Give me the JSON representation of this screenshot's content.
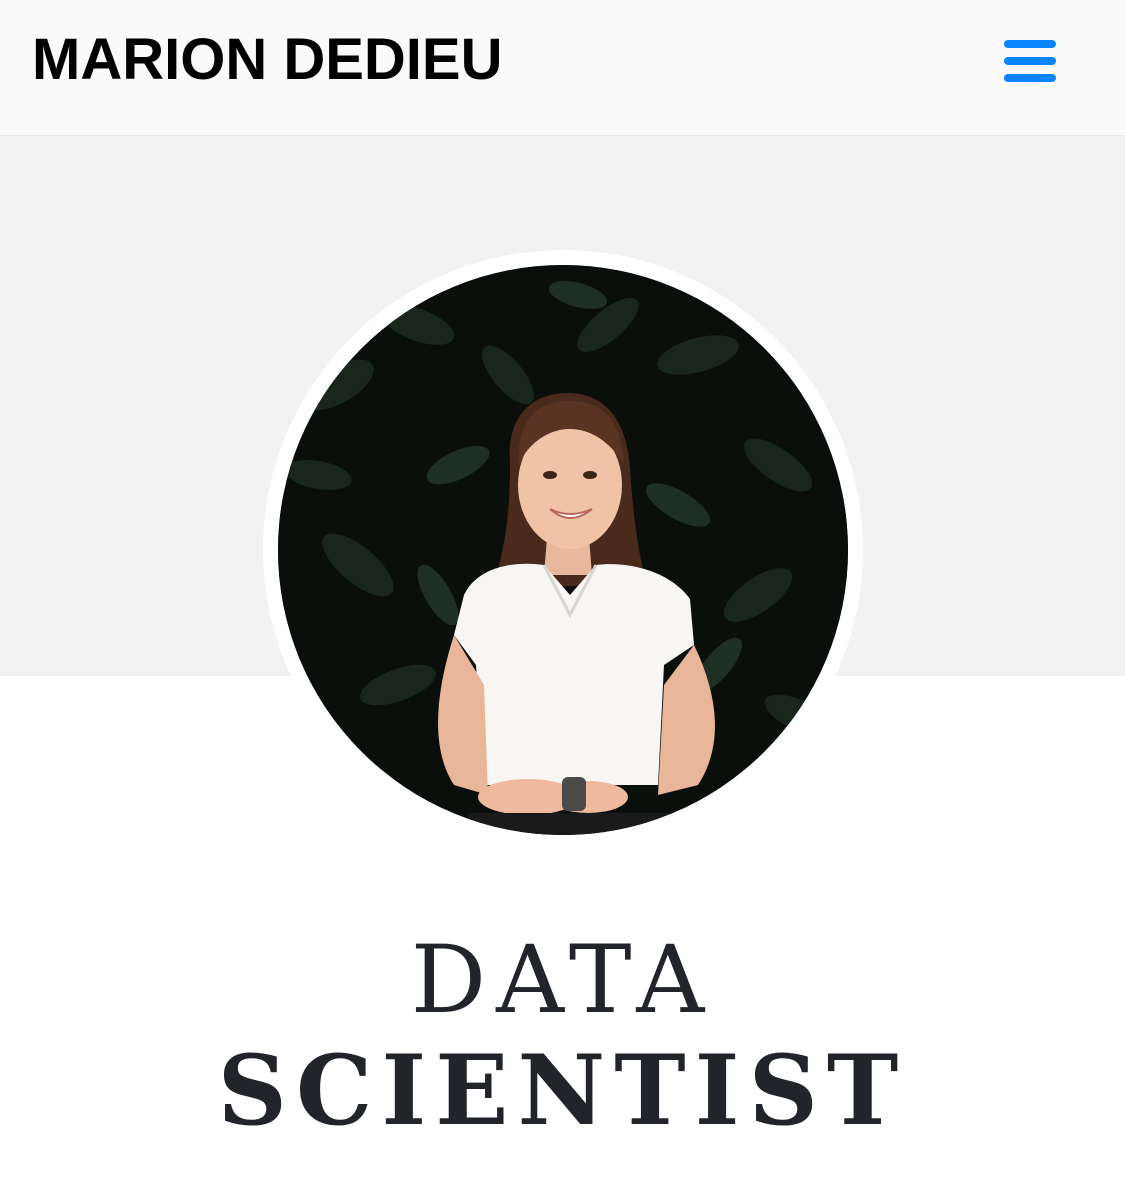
{
  "header": {
    "brand": "MARION DEDIEU",
    "menu_icon": "hamburger-menu-icon",
    "menu_color": "#0a84ff"
  },
  "hero": {
    "background": "#f2f2f2",
    "avatar_description_icon": "profile-photo"
  },
  "headline": {
    "line1": "DATA",
    "line2": "SCIENTIST"
  }
}
